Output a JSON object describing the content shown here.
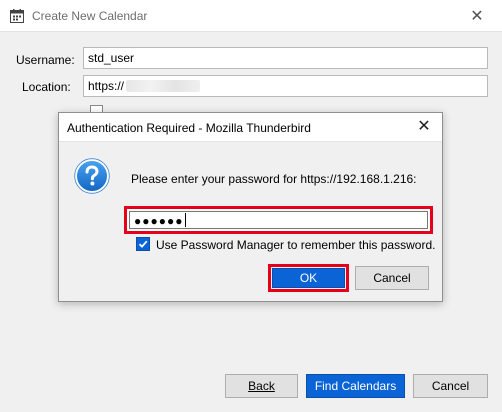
{
  "window": {
    "title": "Create New Calendar",
    "close_glyph": "✕"
  },
  "form": {
    "username_label": "Username:",
    "username_value": "std_user",
    "location_label": "Location:",
    "location_value": "https://"
  },
  "footer": {
    "back_label": "Back",
    "find_label": "Find Calendars",
    "cancel_label": "Cancel"
  },
  "dialog": {
    "title": "Authentication Required - Mozilla Thunderbird",
    "close_glyph": "✕",
    "prompt": "Please enter your password for https://192.168.1.216:",
    "password_mask": "●●●●●●",
    "remember_label": "Use Password Manager to remember this password.",
    "remember_checked": true,
    "ok_label": "OK",
    "cancel_label": "Cancel",
    "icon": "question-icon"
  },
  "colors": {
    "accent": "#0a64d6",
    "highlight": "#e4001b",
    "background": "#f0f0f0"
  }
}
